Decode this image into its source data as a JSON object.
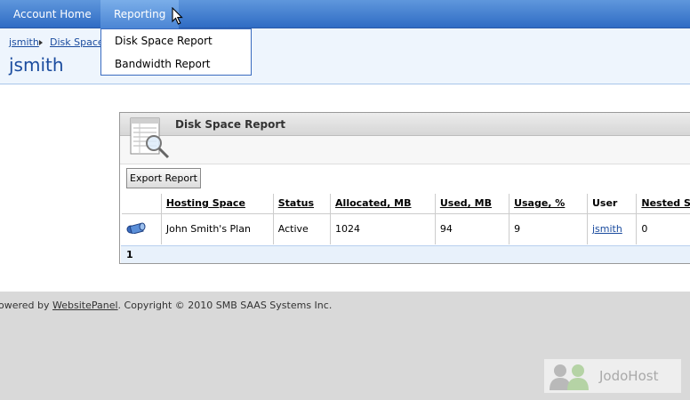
{
  "nav": {
    "account_home": "Account Home",
    "reporting": "Reporting"
  },
  "dropdown": {
    "items": [
      "Disk Space Report",
      "Bandwidth Report"
    ]
  },
  "breadcrumb": {
    "user": "jsmith",
    "current": "Disk Space R"
  },
  "page_title": "jsmith",
  "panel": {
    "title": "Disk Space Report",
    "export_label": "Export Report",
    "columns": [
      "Hosting Space",
      "Status",
      "Allocated, MB",
      "Used, MB",
      "Usage, %",
      "User",
      "Nested S"
    ],
    "rows": [
      {
        "hosting_space": "John Smith's Plan",
        "status": "Active",
        "allocated": "1024",
        "used": "94",
        "usage": "9",
        "user": "jsmith",
        "nested": "0"
      }
    ],
    "pager": "1"
  },
  "footer": {
    "powered_by": "owered by ",
    "link": "WebsitePanel",
    "copyright": ". Copyright © 2010 SMB SAAS Systems Inc."
  },
  "watermark": {
    "text": "JodoHost"
  },
  "colors": {
    "nav_blue": "#2f6cc4",
    "link_blue": "#1a4b9e",
    "header_bg": "#eef5fd",
    "footer_bg": "#d9d9d9"
  }
}
